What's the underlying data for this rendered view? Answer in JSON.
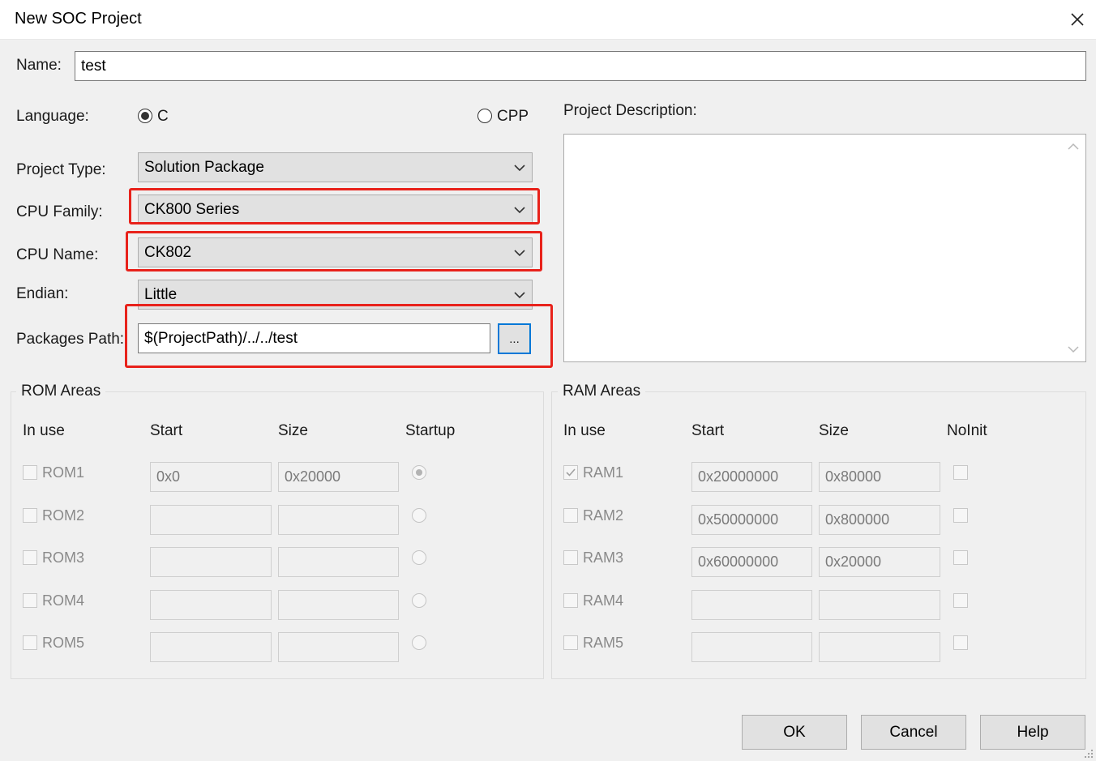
{
  "window": {
    "title": "New SOC Project"
  },
  "name": {
    "label": "Name:",
    "value": "test"
  },
  "language": {
    "label": "Language:",
    "options": [
      {
        "label": "C",
        "selected": true
      },
      {
        "label": "CPP",
        "selected": false
      }
    ]
  },
  "project_type": {
    "label": "Project Type:",
    "value": "Solution Package"
  },
  "cpu_family": {
    "label": "CPU Family:",
    "value": "CK800 Series"
  },
  "cpu_name": {
    "label": "CPU Name:",
    "value": "CK802"
  },
  "endian": {
    "label": "Endian:",
    "value": "Little"
  },
  "packages_path": {
    "label": "Packages Path:",
    "value": "$(ProjectPath)/../../test",
    "browse_label": "..."
  },
  "description": {
    "label": "Project Description:",
    "value": ""
  },
  "highlight_color": "#e8221b",
  "rom": {
    "title": "ROM Areas",
    "headers": {
      "in_use": "In use",
      "start": "Start",
      "size": "Size",
      "startup": "Startup"
    },
    "rows": [
      {
        "name": "ROM1",
        "in_use": false,
        "start": "0x0",
        "size": "0x20000",
        "startup": true
      },
      {
        "name": "ROM2",
        "in_use": false,
        "start": "",
        "size": "",
        "startup": false
      },
      {
        "name": "ROM3",
        "in_use": false,
        "start": "",
        "size": "",
        "startup": false
      },
      {
        "name": "ROM4",
        "in_use": false,
        "start": "",
        "size": "",
        "startup": false
      },
      {
        "name": "ROM5",
        "in_use": false,
        "start": "",
        "size": "",
        "startup": false
      }
    ]
  },
  "ram": {
    "title": "RAM Areas",
    "headers": {
      "in_use": "In use",
      "start": "Start",
      "size": "Size",
      "noinit": "NoInit"
    },
    "rows": [
      {
        "name": "RAM1",
        "in_use": true,
        "start": "0x20000000",
        "size": "0x80000",
        "noinit": false
      },
      {
        "name": "RAM2",
        "in_use": false,
        "start": "0x50000000",
        "size": "0x800000",
        "noinit": false
      },
      {
        "name": "RAM3",
        "in_use": false,
        "start": "0x60000000",
        "size": "0x20000",
        "noinit": false
      },
      {
        "name": "RAM4",
        "in_use": false,
        "start": "",
        "size": "",
        "noinit": false
      },
      {
        "name": "RAM5",
        "in_use": false,
        "start": "",
        "size": "",
        "noinit": false
      }
    ]
  },
  "buttons": {
    "ok": "OK",
    "cancel": "Cancel",
    "help": "Help"
  },
  "icons": {
    "close": "close-icon",
    "dropdown": "chevron-down-icon",
    "scroll_up": "scroll-up-arrow-icon",
    "scroll_down": "scroll-down-arrow-icon",
    "check": "checkmark-icon",
    "grip": "resize-grip-icon"
  }
}
